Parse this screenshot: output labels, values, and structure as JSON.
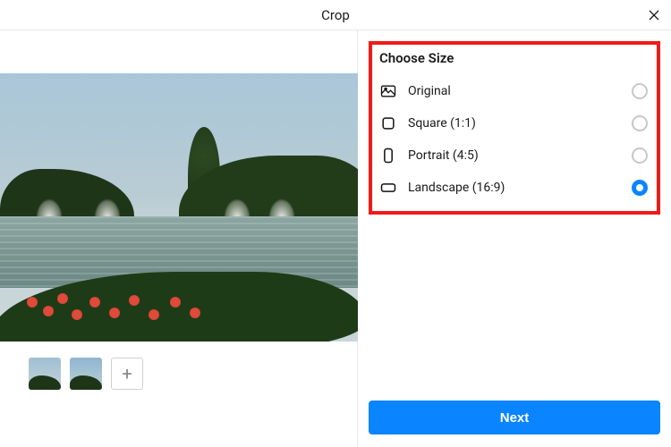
{
  "header": {
    "title": "Crop"
  },
  "icons": {
    "close": "close-icon",
    "add": "+"
  },
  "preview": {
    "alt": "Lake with fountains, trees, and red flowers"
  },
  "thumbnails": {
    "items": [
      {
        "name": "thumbnail-1"
      },
      {
        "name": "thumbnail-2"
      }
    ]
  },
  "sidebar": {
    "title": "Choose Size",
    "options": [
      {
        "id": "original",
        "label": "Original",
        "icon": "image-icon",
        "selected": false
      },
      {
        "id": "square",
        "label": "Square (1:1)",
        "icon": "square-icon",
        "selected": false
      },
      {
        "id": "portrait",
        "label": "Portrait (4:5)",
        "icon": "portrait-icon",
        "selected": false
      },
      {
        "id": "landscape",
        "label": "Landscape (16:9)",
        "icon": "landscape-icon",
        "selected": true
      }
    ],
    "next_label": "Next"
  },
  "colors": {
    "accent": "#0a84ff",
    "highlight": "#ef1b18"
  }
}
